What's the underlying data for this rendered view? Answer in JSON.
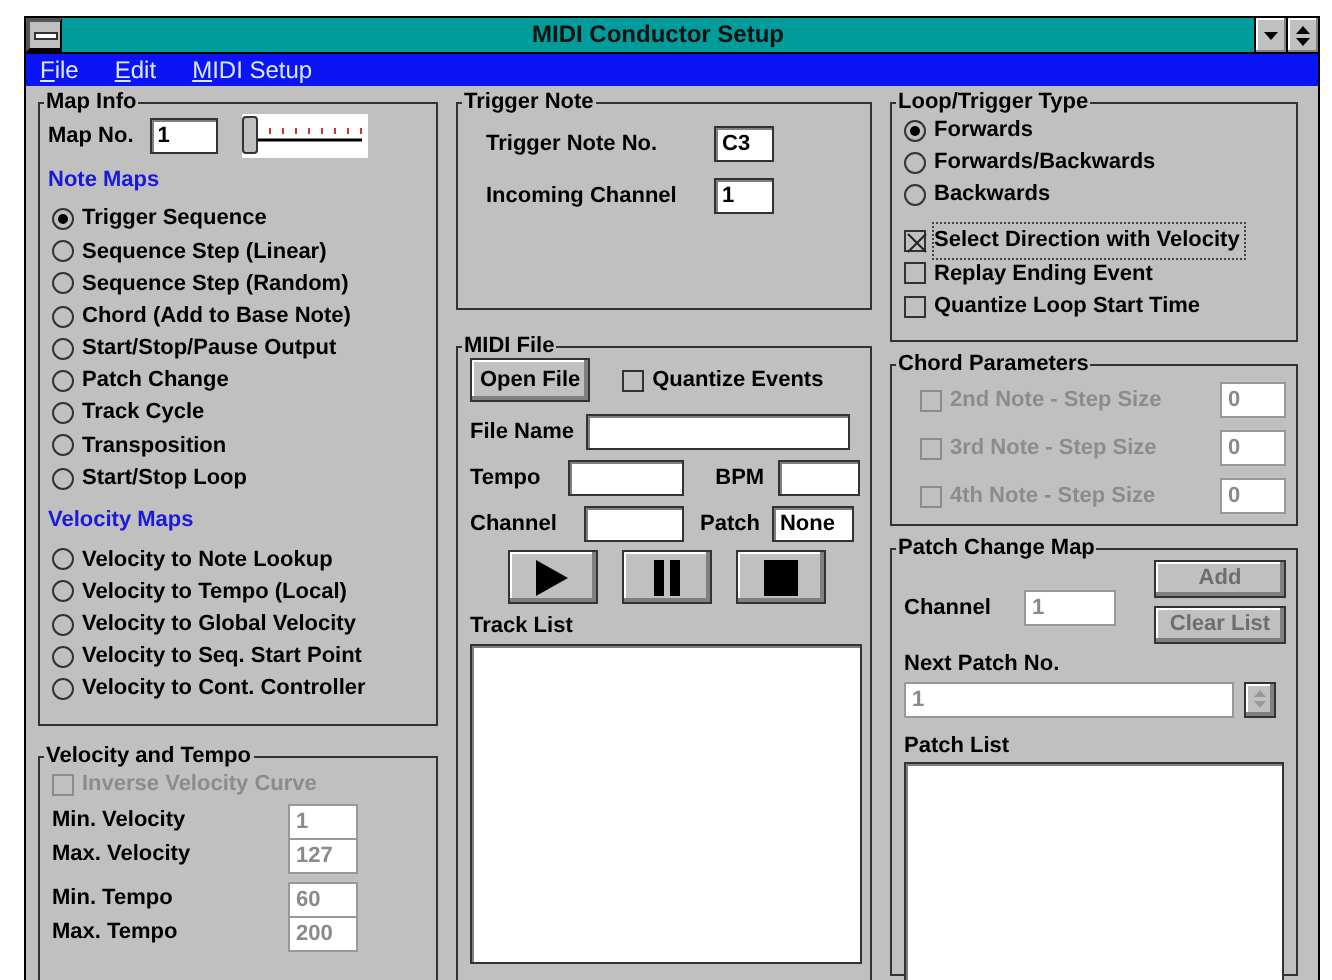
{
  "window": {
    "title": "MIDI Conductor Setup"
  },
  "menu": [
    {
      "label": "File",
      "underline_first": true
    },
    {
      "label": "Edit",
      "underline_first": true
    },
    {
      "label": "MIDI Setup",
      "underline_first": true
    }
  ],
  "map_info": {
    "title": "Map Info",
    "map_no_label": "Map No.",
    "map_no": "1",
    "slider": {
      "level": 0
    }
  },
  "note_maps": {
    "title": "Note Maps",
    "options": [
      {
        "label": "Trigger Sequence",
        "selected": true
      },
      {
        "label": "Sequence Step (Linear)",
        "selected": false
      },
      {
        "label": "Sequence Step (Random)",
        "selected": false
      },
      {
        "label": "Chord (Add to Base Note)",
        "selected": false
      },
      {
        "label": "Start/Stop/Pause Output",
        "selected": false
      },
      {
        "label": "Patch Change",
        "selected": false
      },
      {
        "label": "Track Cycle",
        "selected": false
      },
      {
        "label": "Transposition",
        "selected": false
      },
      {
        "label": "Start/Stop Loop",
        "selected": false
      }
    ]
  },
  "velocity_maps": {
    "title": "Velocity Maps",
    "options": [
      {
        "label": "Velocity to Note Lookup",
        "selected": false
      },
      {
        "label": "Velocity to Tempo (Local)",
        "selected": false
      },
      {
        "label": "Velocity to Global Velocity",
        "selected": false
      },
      {
        "label": "Velocity to Seq. Start Point",
        "selected": false
      },
      {
        "label": "Velocity to Cont. Controller",
        "selected": false
      }
    ]
  },
  "velocity_tempo": {
    "title": "Velocity and Tempo",
    "inverse_curve": {
      "label": "Inverse Velocity Curve",
      "checked": false,
      "disabled": true
    },
    "field_groups": [
      [
        {
          "label": "Min. Velocity",
          "value": "1",
          "disabled": true
        },
        {
          "label": "Max. Velocity",
          "value": "127",
          "disabled": true
        }
      ],
      [
        {
          "label": "Min. Tempo",
          "value": "60",
          "disabled": true
        },
        {
          "label": "Max. Tempo",
          "value": "200",
          "disabled": true
        }
      ]
    ]
  },
  "trigger_note": {
    "title": "Trigger Note",
    "fields": [
      {
        "label": "Trigger Note No.",
        "value": "C3"
      },
      {
        "label": "Incoming Channel",
        "value": "1"
      }
    ]
  },
  "midi_file": {
    "title": "MIDI File",
    "open_button": "Open File",
    "quantize": {
      "label": "Quantize Events",
      "checked": false
    },
    "file_name": {
      "label": "File Name"
    },
    "tempo": {
      "label": "Tempo"
    },
    "bpm": {
      "label": "BPM"
    },
    "channel": {
      "label": "Channel"
    },
    "patch": {
      "label": "Patch",
      "value": "None"
    },
    "transport": [
      {
        "kind": "play"
      },
      {
        "kind": "pause"
      },
      {
        "kind": "stop"
      }
    ],
    "track_list": {
      "label": "Track List"
    }
  },
  "loop_trigger": {
    "title": "Loop/Trigger Type",
    "options": [
      {
        "label": "Forwards",
        "selected": true
      },
      {
        "label": "Forwards/Backwards",
        "selected": false
      },
      {
        "label": "Backwards",
        "selected": false
      }
    ],
    "checks": [
      {
        "label": "Select Direction with Velocity",
        "checked": true,
        "focused": true
      },
      {
        "label": "Replay Ending Event",
        "checked": false,
        "focused": false
      },
      {
        "label": "Quantize Loop Start Time",
        "checked": false,
        "focused": false
      }
    ]
  },
  "chord_parameters": {
    "title": "Chord Parameters",
    "rows": [
      {
        "label": "2nd Note - Step Size",
        "value": "0",
        "checked": false,
        "disabled": true
      },
      {
        "label": "3rd Note - Step Size",
        "value": "0",
        "checked": false,
        "disabled": true
      },
      {
        "label": "4th Note - Step Size",
        "value": "0",
        "checked": false,
        "disabled": true
      }
    ]
  },
  "patch_change_map": {
    "title": "Patch Change Map",
    "channel": {
      "label": "Channel",
      "value": "1",
      "disabled": true
    },
    "buttons": [
      {
        "label": "Add",
        "disabled": true
      },
      {
        "label": "Clear List",
        "disabled": true
      }
    ],
    "next_patch": {
      "label": "Next Patch No.",
      "value": "1",
      "disabled": true
    },
    "patch_list": {
      "label": "Patch List"
    }
  }
}
